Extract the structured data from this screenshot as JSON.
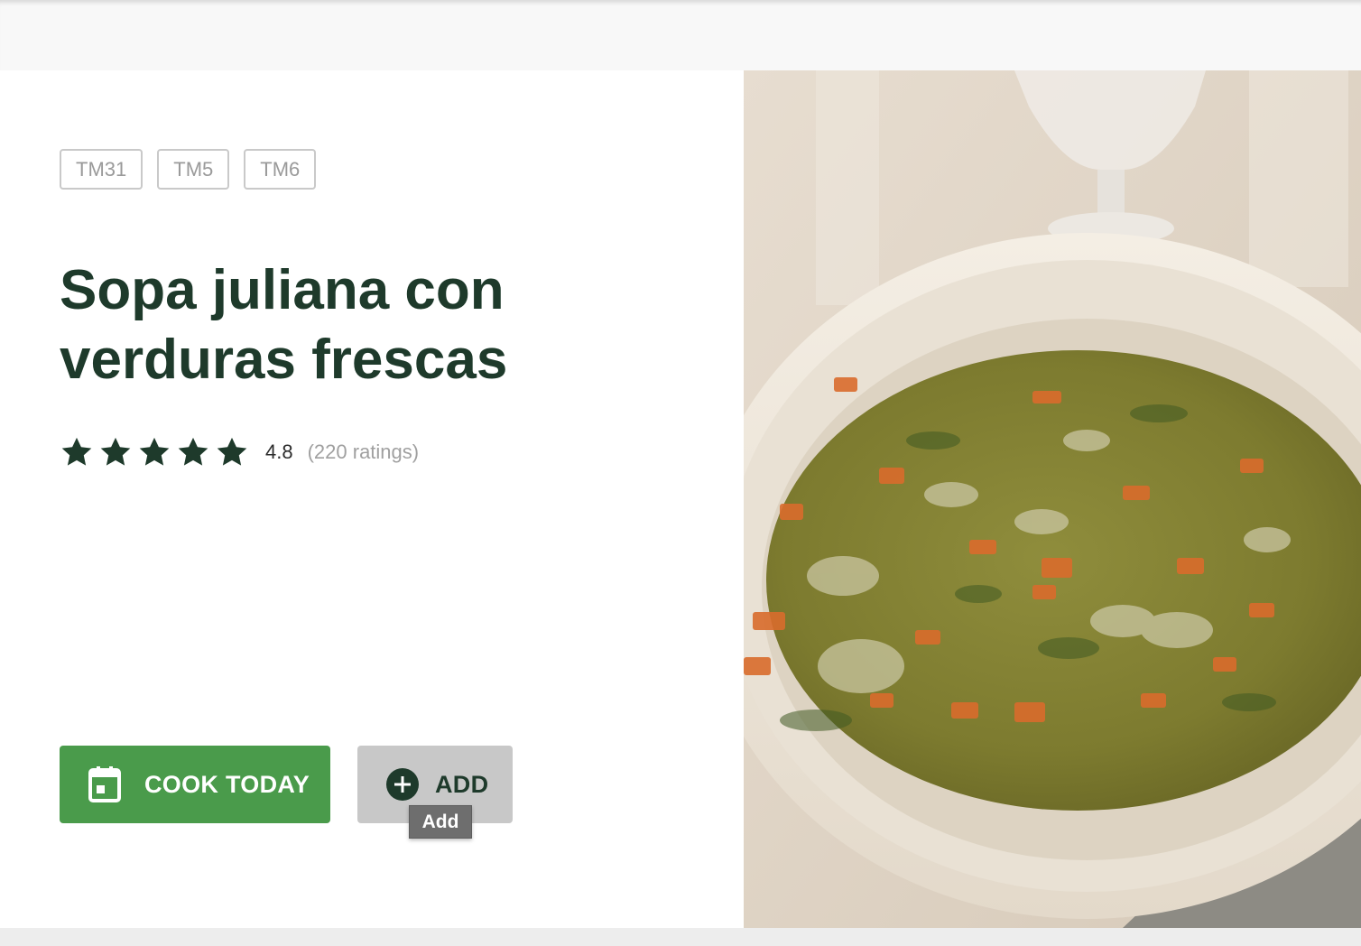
{
  "recipe": {
    "devices": [
      "TM31",
      "TM5",
      "TM6"
    ],
    "title": "Sopa juliana con verduras frescas",
    "rating": {
      "stars": 5,
      "value": "4.8",
      "count_text": "(220 ratings)"
    },
    "image_alt": "Bowl of vegetable soup"
  },
  "actions": {
    "cook_today_label": "COOK TODAY",
    "add_label": "ADD",
    "add_tooltip": "Add"
  },
  "colors": {
    "primary_green": "#4a9b4b",
    "title_dark_green": "#1e3a2b",
    "tag_border": "#c9c9c9",
    "add_button_bg": "#c8c8c8"
  },
  "icons": {
    "cook_today": "calendar-icon",
    "add": "plus-circle-icon",
    "rating": "star-icon"
  }
}
